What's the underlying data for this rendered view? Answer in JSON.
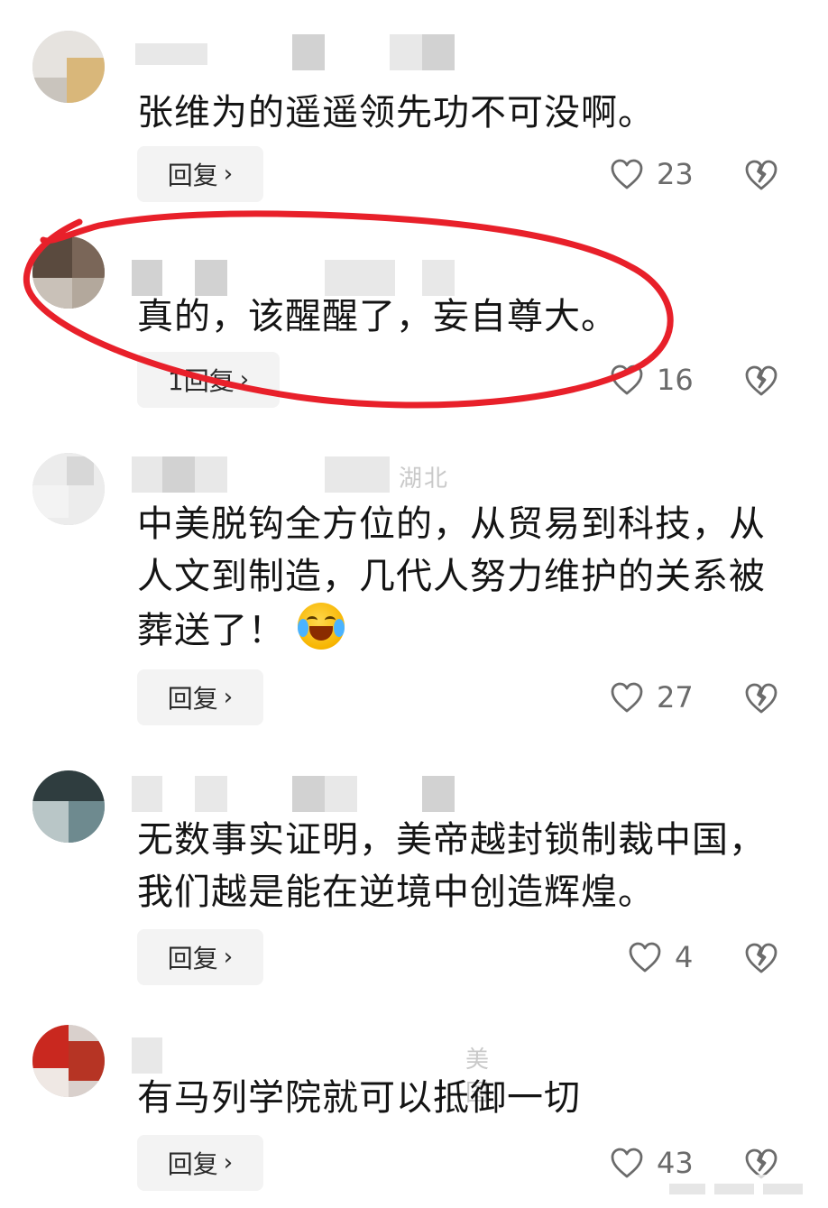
{
  "comments": [
    {
      "text": "张维为的遥遥领先功不可没啊。",
      "reply_label": "回复",
      "likes": "23",
      "icons": {
        "like": "heart-outline-icon",
        "dislike": "broken-heart-icon",
        "chevron": "chevron-right-icon"
      }
    },
    {
      "text": "真的，该醒醒了，妄自尊大。",
      "reply_label": "1回复",
      "likes": "16",
      "icons": {
        "like": "heart-outline-icon",
        "dislike": "broken-heart-icon",
        "chevron": "chevron-right-icon"
      }
    },
    {
      "meta_partial": "湖北",
      "text": "中美脱钩全方位的，从贸易到科技，从人文到制造，几代人努力维护的关系被葬送了！",
      "emoji": "rolling-on-floor-laughing-emoji",
      "reply_label": "回复",
      "likes": "27",
      "icons": {
        "like": "heart-outline-icon",
        "dislike": "broken-heart-icon",
        "chevron": "chevron-right-icon"
      }
    },
    {
      "text": "无数事实证明，美帝越封锁制裁中国，我们越是能在逆境中创造辉煌。",
      "reply_label": "回复",
      "likes": "4",
      "icons": {
        "like": "heart-outline-icon",
        "dislike": "broken-heart-icon",
        "chevron": "chevron-right-icon"
      }
    },
    {
      "meta_partial": "美国",
      "text": "有马列学院就可以抵御一切",
      "reply_label": "回复",
      "likes": "43",
      "icons": {
        "like": "heart-outline-icon",
        "dislike": "broken-heart-icon",
        "chevron": "chevron-right-icon"
      }
    }
  ],
  "colors": {
    "annotation": "#e8202a",
    "text": "#141414",
    "meta_gray": "#6b6b6b",
    "button_bg": "#f3f3f3"
  }
}
